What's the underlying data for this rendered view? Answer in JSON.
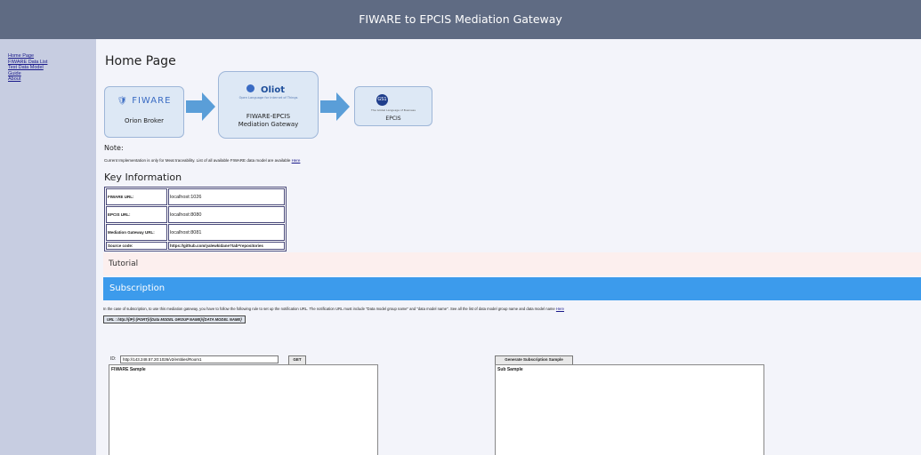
{
  "header": {
    "title": "FIWARE to EPCIS Mediation Gateway"
  },
  "sidebar": {
    "items": [
      {
        "label": "Home Page"
      },
      {
        "label": "FIWARE Data List"
      },
      {
        "label": "Test Data Model"
      },
      {
        "label": "Guide"
      },
      {
        "label": "About"
      }
    ]
  },
  "main": {
    "page_title": "Home Page",
    "diagram": {
      "orion_logo": "FIWARE",
      "orion_label": "Orion Broker",
      "gateway_logo": "Oliot",
      "gateway_logo_sub": "Open Language for Internet of Things",
      "gateway_label_1": "FIWARE-EPCIS",
      "gateway_label_2": "Mediation Gateway",
      "epcis_logo": "GS1",
      "epcis_logo_sub": "The Global Language of Business",
      "epcis_label": "EPCIS"
    },
    "note_label": "Note:",
    "note_text": "Current Implementation is only for Meat traceability. List of all available FIWARE data model are available",
    "note_link": "Here",
    "key_title": "Key Information",
    "key_rows": [
      {
        "key": "FIWARE URL:",
        "value": "localhost:1026"
      },
      {
        "key": "EPCIS URL:",
        "value": "localhost:8080"
      },
      {
        "key": "Mediation Gateway URL:",
        "value": "localhost:8081"
      },
      {
        "key": "Source code:",
        "value": "https://github.com/yalewkidane?tab=repositories"
      }
    ],
    "tutorial_label": "Tutorial",
    "subscription_label": "Subscription",
    "sub_desc": "In the case of subscription, to use this mediation gateway, you have to follow the following rule to set up the notification URL. The notification URL must include \"Data model group name\" and \"data model name\". See all the list of data model group name and data model name",
    "sub_link": "Here",
    "url_prefix": "URL : http://{IP}:{PORT}/",
    "url_pattern": "{Data MODEL GROUP NAME}/{DATA MODEL NAME}",
    "id_label": "ID:",
    "id_value": "http://143.248.57.20:1026/v2/entities/Room1",
    "get_button": "GET",
    "gen_button": "Generate Subscription Sample",
    "fiware_sample": "FIWARE Sample",
    "sub_sample": "Sub Sample"
  },
  "colors": {
    "header_bg": "#5f6b83",
    "sidebar_bg": "#c7cde1",
    "subscription_bar": "#3c9bec",
    "tutorial_bar": "#fcefee"
  }
}
